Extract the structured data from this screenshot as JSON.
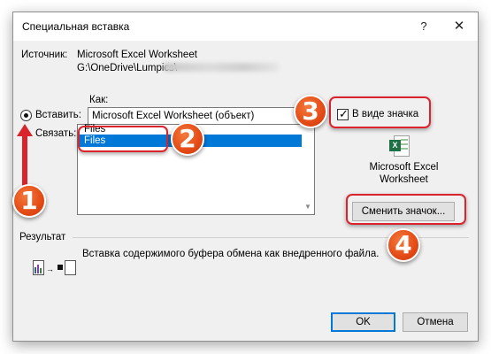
{
  "dialog": {
    "title": "Специальная вставка",
    "help": "?",
    "close": "✕"
  },
  "source": {
    "label": "Источник:",
    "name": "Microsoft Excel Worksheet",
    "path": "G:\\OneDrive\\Lumpics\\"
  },
  "as_label": "Как:",
  "options": {
    "paste_label": "Вставить:",
    "link_label": "Связать:",
    "paste_selected": true
  },
  "format_combo": {
    "value": "Microsoft Excel Worksheet (объект)"
  },
  "format_list": {
    "items": [
      "Files",
      "Files"
    ],
    "selected_index": 1
  },
  "display_as_icon": {
    "label": "В виде значка",
    "checked": true,
    "check_glyph": "✓"
  },
  "icon_preview": {
    "caption_line1": "Microsoft Excel",
    "caption_line2": "Worksheet",
    "glyph": "X"
  },
  "change_icon_button": "Сменить значок...",
  "result": {
    "label": "Результат",
    "text": "Вставка содержимого буфера обмена как внедренного файла."
  },
  "buttons": {
    "ok": "OK",
    "cancel": "Отмена"
  },
  "annotations": {
    "badge1": "1",
    "badge2": "2",
    "badge3": "3",
    "badge4": "4",
    "highlight_color": "#d9232d",
    "badge_color": "#e34a16"
  }
}
